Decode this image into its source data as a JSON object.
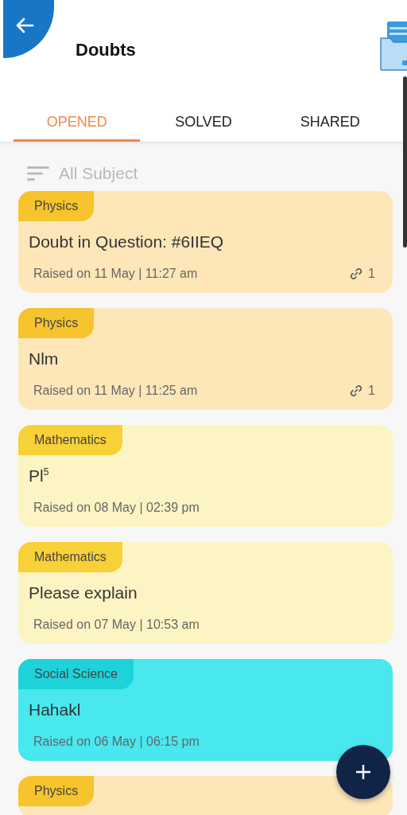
{
  "header": {
    "title": "Doubts"
  },
  "tabs": [
    {
      "label": "OPENED",
      "selected": true
    },
    {
      "label": "SOLVED",
      "selected": false
    },
    {
      "label": "SHARED",
      "selected": false
    }
  ],
  "filter": {
    "label": "All Subject"
  },
  "doubts": [
    {
      "subject": "Physics",
      "title": "Doubt in Question: #6IIEQ",
      "raised": "Raised on 11 May | 11:27 am",
      "links": "1",
      "color": "#fde7b9"
    },
    {
      "subject": "Physics",
      "title": "Nlm",
      "raised": "Raised on 11 May | 11:25 am",
      "links": "1",
      "color": "#fde7b9"
    },
    {
      "subject": "Mathematics",
      "title": "Pl$^{5}$",
      "raised": "Raised on 08 May | 02:39 pm",
      "color": "#fdf4c3"
    },
    {
      "subject": "Mathematics",
      "title": "Please explain",
      "raised": "Raised on 07 May | 10:53 am",
      "color": "#fdf4c3"
    },
    {
      "subject": "Social Science",
      "title": "Hahakl",
      "raised": "Raised on 06 May | 06:15 pm",
      "color": "#48e8ee"
    },
    {
      "subject": "Physics",
      "color": "#fde7b9"
    }
  ]
}
